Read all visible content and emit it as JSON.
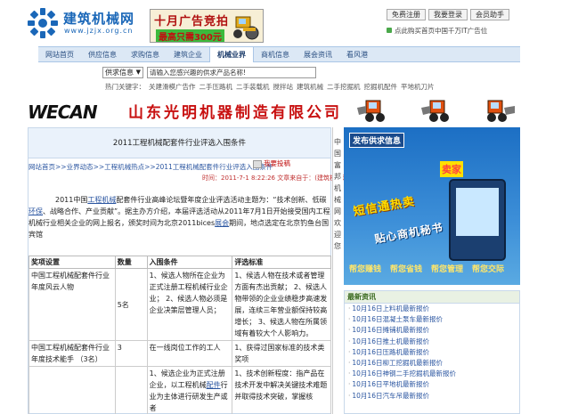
{
  "site": {
    "title": "建筑机械网",
    "url": "www.jzjx.org.cn"
  },
  "ad_banner": {
    "line1": "十月广告竞拍",
    "line2": "最高只需300元"
  },
  "top_buttons": [
    "免费注册",
    "我要登录",
    "会员助手"
  ],
  "top_promo": "点此购买首页中国千万IT广告位",
  "nav": {
    "items": [
      "网站首页",
      "供应信息",
      "求购信息",
      "建筑企业",
      "机械业界",
      "商机信息",
      "展会资讯",
      "看风港"
    ],
    "active_index": 4
  },
  "search": {
    "select_value": "供求信息",
    "placeholder": "请输入您感兴趣的供求产品名称!"
  },
  "hotwords": {
    "label": "热门关键字：",
    "items": [
      "关建滑模广告作",
      "二手压路机",
      "二手装载机",
      "搅拌站",
      "建筑机械",
      "二手挖掘机",
      "挖掘机配件",
      "平地机刀片"
    ]
  },
  "company_banner": {
    "logo": "WECAN",
    "name": "山东光明机器制造有限公司"
  },
  "article": {
    "title": "2011工程机械配套件行业评选入围条件",
    "breadcrumb": "网站首页>>业界动态>>工程机械热点>>2011工程机械配套件行业评选入围条件",
    "report_button": "我要投稿",
    "meta": "时间：2011-7-1 8:22:26  文章来自于：(建筑机械网)",
    "body_pre": "2011中国",
    "body_link1": "工程机械",
    "body_mid1": "配套件行业高峰论坛暨年度企业评选活动主题为：“技术创新、低碳",
    "body_link2": "环保",
    "body_mid2": "、战略合作、产业贡献”。据主办方介绍，本届评选活动从2011年7月1日开始接受国内工程机械行业相关企业的网上报名，颁奖时间为北京2011bices",
    "body_link3": "展会",
    "body_end": "期间，地点选定在北京钓鱼台国宾馆"
  },
  "table": {
    "headers": [
      "奖项设置",
      "数量",
      "入围条件",
      "评选标准"
    ],
    "rows": [
      {
        "award": "中国工程机械配套件行业年度风云人物",
        "count": "5名",
        "condition": "1、候选人物所在企业为正式注册工程机械行业企业；  2、候选人物必须是企业决策层管理人员；",
        "standard": "1、候选人物在技术或者管理方面有杰出贡献；  2、候选人物带领的企业业绩稳步高速发展，连续三年营业额保持较高增长；  3、候选人物在所属领域有着较大个人影响力。"
      },
      {
        "award": "中国工程机械配套件行业年度技术能手  （3名）",
        "count": "3",
        "condition": "在一线岗位工作的工人",
        "standard": "1、获得过国家标准的技术类奖项"
      },
      {
        "award": "",
        "count": "",
        "condition_pre": "1、候选企业为正式注册企业，以工程机械",
        "condition_link": "配件",
        "condition_post": "行业为主体进行研发生产或者",
        "standard": "1、技术创新程度：指产品在技术开发中解决关键技术难题并取得技术突破，掌握核"
      }
    ]
  },
  "vertical_strip": "中国富邦机械网欢迎您",
  "right_ad": {
    "publish_label": "发布供求信息",
    "seller_label": "卖家",
    "slogan1": "短信通热卖",
    "slogan2": "贴心商机秘书",
    "footer_items": [
      "帮您赚钱",
      "帮您省钱",
      "帮您管理",
      "帮您交际"
    ]
  },
  "news": {
    "title": "最新资讯",
    "items": [
      "10月16日上料机最新报价",
      "10月16日混凝土泵车最新报价",
      "10月16日摊铺机最新报价",
      "10月16日推土机最新报价",
      "10月16日压路机最新报价",
      "10月16日柳工挖掘机最新报价",
      "10月16日神钢二手挖掘机最新报价",
      "10月16日平地机最新报价",
      "10月16日汽车吊最新报价"
    ]
  }
}
